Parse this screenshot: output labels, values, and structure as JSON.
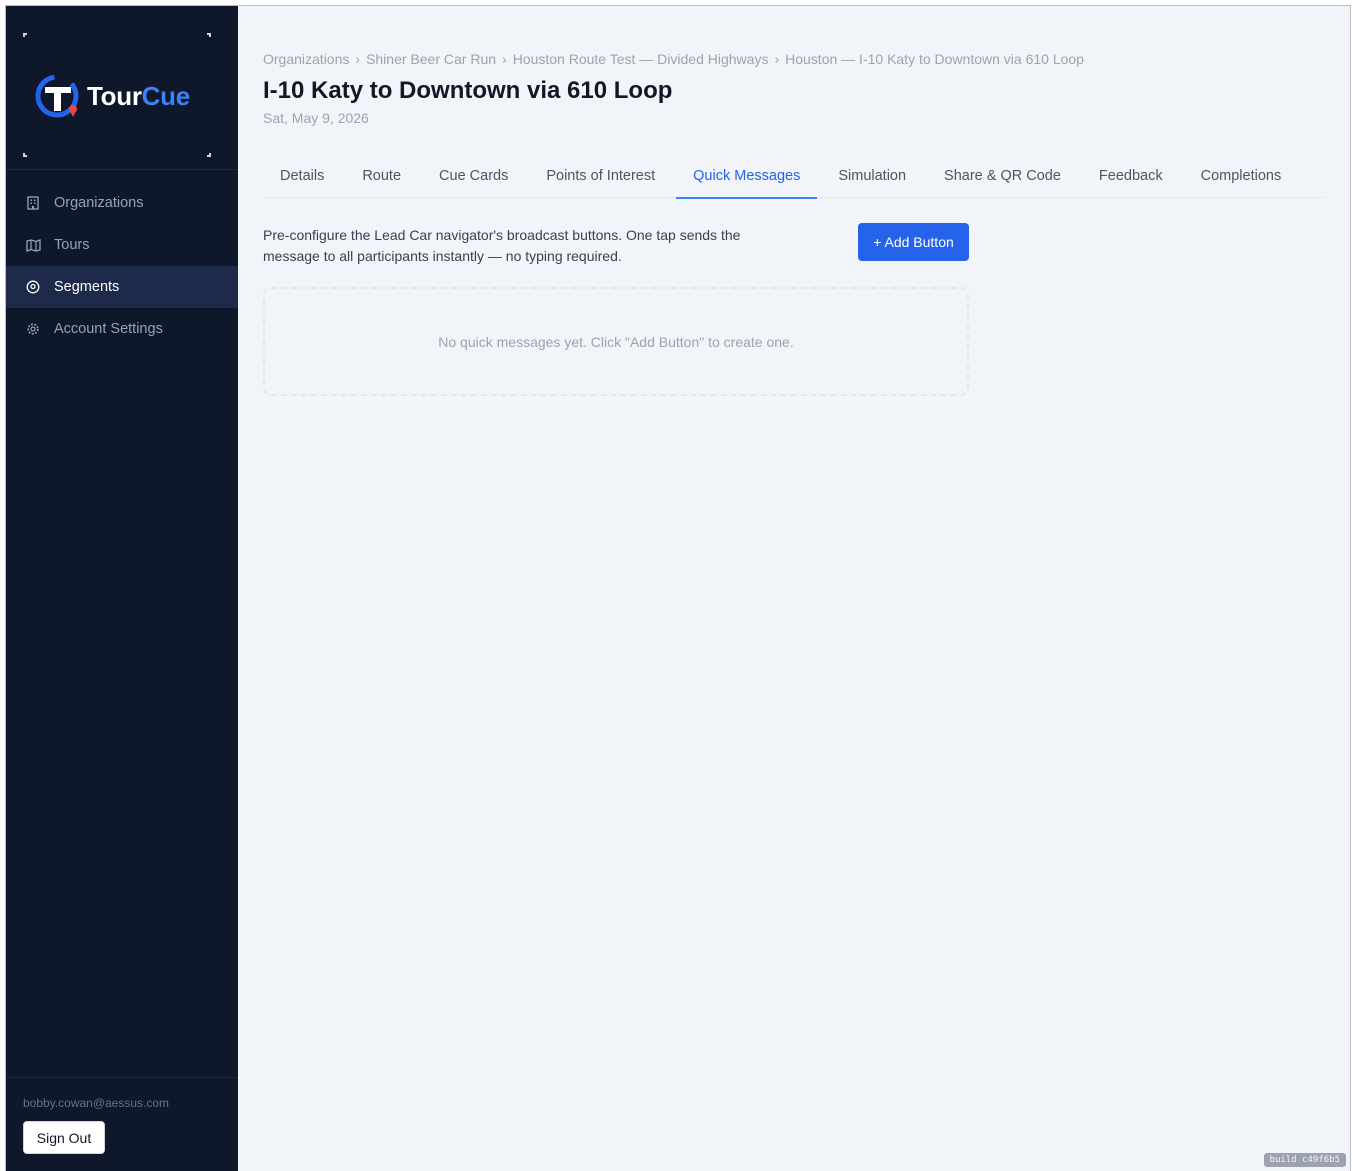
{
  "brand": {
    "name_part1": "Tour",
    "name_part2": "Cue",
    "accent": "#3b82f6"
  },
  "sidebar": {
    "items": [
      {
        "label": "Organizations",
        "icon": "building-icon",
        "active": false
      },
      {
        "label": "Tours",
        "icon": "map-icon",
        "active": false
      },
      {
        "label": "Segments",
        "icon": "map-pin-icon",
        "active": true
      },
      {
        "label": "Account Settings",
        "icon": "gear-icon",
        "active": false
      }
    ],
    "user_email": "bobby.cowan@aessus.com",
    "sign_out_label": "Sign Out"
  },
  "breadcrumb": {
    "items": [
      "Organizations",
      "Shiner Beer Car Run",
      "Houston Route Test — Divided Highways",
      "Houston — I-10 Katy to Downtown via 610 Loop"
    ],
    "separator": "›"
  },
  "page": {
    "title": "I-10 Katy to Downtown via 610 Loop",
    "date": "Sat, May 9, 2026"
  },
  "tabs": [
    {
      "label": "Details",
      "active": false
    },
    {
      "label": "Route",
      "active": false
    },
    {
      "label": "Cue Cards",
      "active": false
    },
    {
      "label": "Points of Interest",
      "active": false
    },
    {
      "label": "Quick Messages",
      "active": true
    },
    {
      "label": "Simulation",
      "active": false
    },
    {
      "label": "Share & QR Code",
      "active": false
    },
    {
      "label": "Feedback",
      "active": false
    },
    {
      "label": "Completions",
      "active": false
    }
  ],
  "quick_messages": {
    "description": "Pre-configure the Lead Car navigator's broadcast buttons. One tap sends the message to all participants instantly — no typing required.",
    "add_button_label": "+ Add Button",
    "empty_text": "No quick messages yet. Click \"Add Button\" to create one."
  },
  "build": {
    "label": "build c49f6b5"
  },
  "colors": {
    "sidebar_bg": "#0f172a",
    "active_tab": "#2563eb",
    "primary_button": "#2563eb"
  }
}
